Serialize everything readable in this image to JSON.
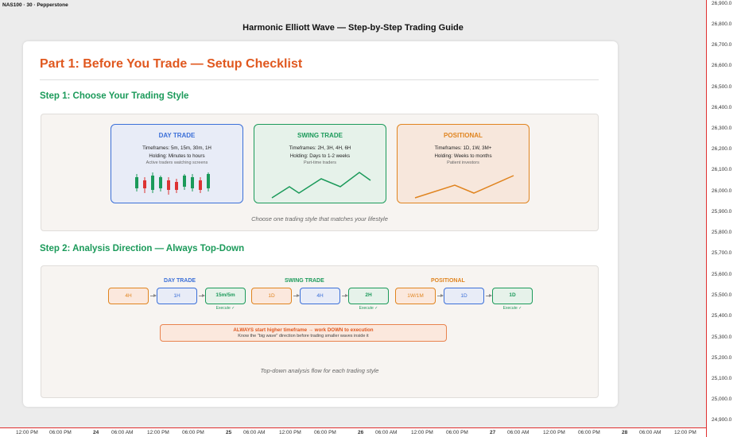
{
  "symbol": "NAS100 · 30 · Pepperstone",
  "main_title": "Harmonic Elliott Wave — Step-by-Step Trading Guide",
  "price_axis": [
    "26,900.0",
    "26,800.0",
    "26,700.0",
    "26,600.0",
    "26,500.0",
    "26,400.0",
    "26,300.0",
    "26,200.0",
    "26,100.0",
    "26,000.0",
    "25,900.0",
    "25,800.0",
    "25,700.0",
    "25,600.0",
    "25,500.0",
    "25,400.0",
    "25,300.0",
    "25,200.0",
    "25,100.0",
    "25,000.0",
    "24,900.0"
  ],
  "time_axis": [
    "12:00 PM",
    "06:00 PM",
    "24",
    "06:00 AM",
    "12:00 PM",
    "06:00 PM",
    "25",
    "06:00 AM",
    "12:00 PM",
    "06:00 PM",
    "26",
    "06:00 AM",
    "12:00 PM",
    "06:00 PM",
    "27",
    "06:00 AM",
    "12:00 PM",
    "06:00 PM",
    "28",
    "06:00 AM",
    "12:00 PM"
  ],
  "guide": {
    "part_title": "Part 1: Before You Trade — Setup Checklist",
    "step1": {
      "title": "Step 1: Choose Your Trading Style",
      "styles": [
        {
          "name": "DAY TRADE",
          "timeframes": "Timeframes: 5m, 15m, 30m, 1H",
          "holding": "Holding: Minutes to hours",
          "note": "Active traders watching screens",
          "color": "#3b6fd8"
        },
        {
          "name": "SWING TRADE",
          "timeframes": "Timeframes: 2H, 3H, 4H, 6H",
          "holding": "Holding: Days to 1-2 weeks",
          "note": "Part-time traders",
          "color": "#1b9a5a"
        },
        {
          "name": "POSITIONAL",
          "timeframes": "Timeframes: 1D, 1W, 3M+",
          "holding": "Holding: Weeks to months",
          "note": "Patient investors",
          "color": "#e0841f"
        }
      ],
      "caption": "Choose one trading style that matches your lifestyle"
    },
    "step2": {
      "title": "Step 2: Analysis Direction — Always Top-Down",
      "groups": [
        {
          "label": "DAY TRADE",
          "color": "#3b6fd8",
          "frames": [
            "4H",
            "1H",
            "15m/5m"
          ],
          "execute": "Execute ✓"
        },
        {
          "label": "SWING TRADE",
          "color": "#1b9a5a",
          "frames": [
            "1D",
            "4H",
            "2H"
          ],
          "execute": "Execute ✓"
        },
        {
          "label": "POSITIONAL",
          "color": "#e0841f",
          "frames": [
            "1W/1M",
            "1D",
            "1D"
          ],
          "execute": "Execute ✓"
        }
      ],
      "note_main": "ALWAYS start higher timeframe → work DOWN to execution",
      "note_sub": "Know the \"big wave\" direction before trading smaller waves inside it",
      "caption": "Top-down analysis flow for each trading style"
    }
  }
}
